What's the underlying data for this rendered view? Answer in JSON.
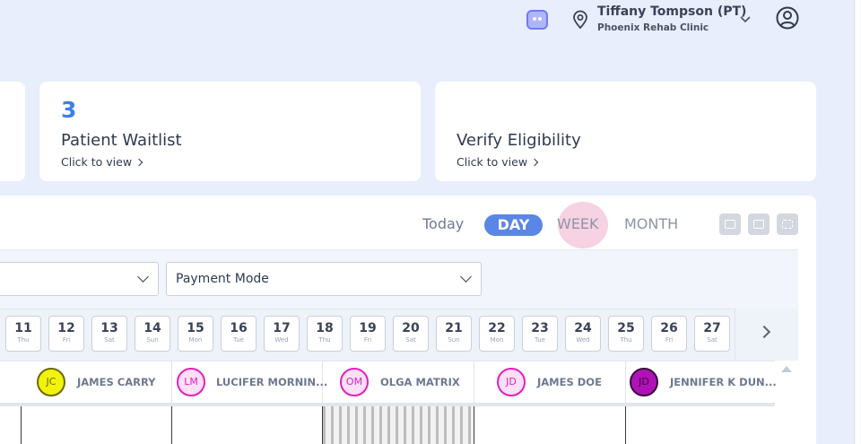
{
  "header": {
    "user_name": "Tiffany Tompson (PT)",
    "clinic_name": "Phoenix Rehab Clinic",
    "icons": [
      "chat-icon",
      "location-pin-icon",
      "chevron-down-icon",
      "user-avatar-icon"
    ],
    "accent_color": "#6f7bf0"
  },
  "cards": {
    "waitlist": {
      "count": "3",
      "title": "Patient Waitlist",
      "link": "Click to view"
    },
    "verify": {
      "title": "Verify Eligibility",
      "link": "Click to view"
    }
  },
  "calendar": {
    "views": {
      "today": "Today",
      "day": "DAY",
      "week": "WEEK",
      "month": "MONTH"
    },
    "active_view": "DAY",
    "toolbar_icons": [
      "print-icon",
      "save-icon",
      "fullscreen-icon"
    ],
    "filters": {
      "payment_mode": "Payment Mode"
    },
    "days": [
      {
        "num": "11",
        "wd": "Thu"
      },
      {
        "num": "12",
        "wd": "Fri"
      },
      {
        "num": "13",
        "wd": "Sat"
      },
      {
        "num": "14",
        "wd": "Sun"
      },
      {
        "num": "15",
        "wd": "Mon"
      },
      {
        "num": "16",
        "wd": "Tue"
      },
      {
        "num": "17",
        "wd": "Wed"
      },
      {
        "num": "18",
        "wd": "Thu"
      },
      {
        "num": "19",
        "wd": "Fri"
      },
      {
        "num": "20",
        "wd": "Sat"
      },
      {
        "num": "21",
        "wd": "Sun"
      },
      {
        "num": "22",
        "wd": "Mon"
      },
      {
        "num": "23",
        "wd": "Tue"
      },
      {
        "num": "24",
        "wd": "Wed"
      },
      {
        "num": "25",
        "wd": "Thu"
      },
      {
        "num": "26",
        "wd": "Fri"
      },
      {
        "num": "27",
        "wd": "Sat"
      }
    ],
    "providers": [
      {
        "initials": "JC",
        "name": "JAMES CARRY",
        "fill": "#f2f20f",
        "border": "#6b6b00",
        "text": "#6b6b00"
      },
      {
        "initials": "LM",
        "name": "LUCIFER MORNIN...",
        "fill": "#fde0f7",
        "border": "#e020c0",
        "text": "#e020c0"
      },
      {
        "initials": "OM",
        "name": "OLGA MATRIX",
        "fill": "#fde0f7",
        "border": "#e020c0",
        "text": "#e020c0"
      },
      {
        "initials": "JD",
        "name": "JAMES DOE",
        "fill": "#fde0f7",
        "border": "#e020c0",
        "text": "#e020c0"
      },
      {
        "initials": "JD",
        "name": "JENNIFER K DUN...",
        "fill": "#b012b8",
        "border": "#3a0a3e",
        "text": "#3a0a3e"
      }
    ]
  }
}
